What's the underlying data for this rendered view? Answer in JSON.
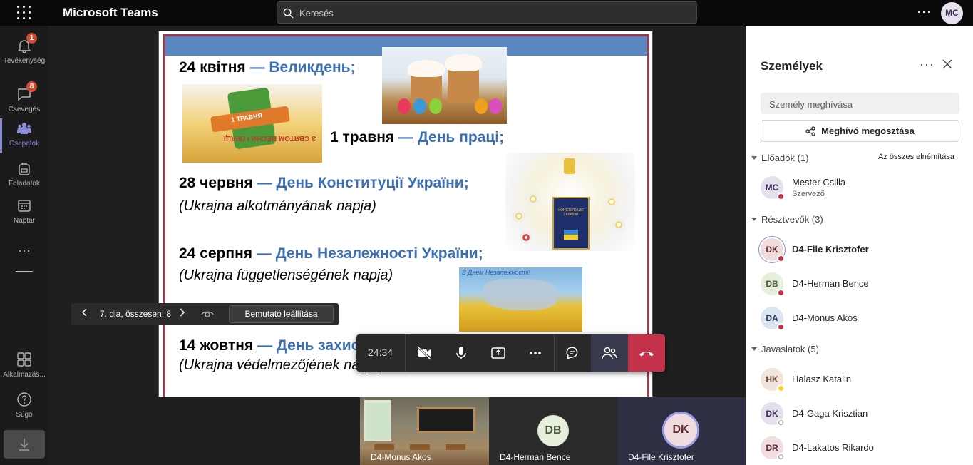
{
  "app": {
    "title": "Microsoft Teams",
    "search_placeholder": "Keresés",
    "avatar_initials": "MC",
    "more": "···"
  },
  "sidebar": {
    "items": [
      {
        "label": "Tevékenység",
        "badge": "1"
      },
      {
        "label": "Csevegés",
        "badge": "8"
      },
      {
        "label": "Csapatok",
        "badge": ""
      },
      {
        "label": "Feladatok",
        "badge": ""
      },
      {
        "label": "Naptár",
        "badge": ""
      }
    ],
    "more": "···",
    "bottom": [
      {
        "label": "Alkalmazás..."
      },
      {
        "label": "Súgó"
      }
    ]
  },
  "slide": {
    "lines": [
      {
        "date": "24 квітня",
        "holiday": "— Великдень;"
      },
      {
        "date": "1 травня",
        "holiday": "— День праці;"
      },
      {
        "date": "28 червня",
        "holiday": "— День Конституції України;"
      },
      {
        "sub": "(Ukrajna alkotmányának napja)"
      },
      {
        "date": "24 серпня",
        "holiday": "— День Незалежності України;"
      },
      {
        "sub": "(Ukrajna függetlenségének napja)"
      },
      {
        "date": "14 жовтня",
        "holiday": "— День захисника України;"
      },
      {
        "sub": "(Ukrajna védelmezőjének napja)"
      }
    ],
    "may_image_text": "З СВЯТОМ ВЕСНИ І ПРАЦІ",
    "may_image_badge": "1 ТРАВНЯ",
    "indep_image_text": "З Днем Незалежності!",
    "const_book_text": "КОНСТИТУЦІЯ УКРАЇНИ"
  },
  "present_bar": {
    "counter": "7. dia, összesen: 8",
    "stop_label": "Bemutató leállítása"
  },
  "call": {
    "timer": "24:34"
  },
  "video_tiles": [
    {
      "name": "D4-Monus Akos",
      "initials": ""
    },
    {
      "name": "D4-Herman Bence",
      "initials": "DB"
    },
    {
      "name": "D4-File Krisztofer",
      "initials": "DK"
    }
  ],
  "panel": {
    "title": "Személyek",
    "more": "···",
    "invite_placeholder": "Személy meghívása",
    "share_label": "Meghívó megosztása",
    "presenters_label": "Előadók (1)",
    "mute_all": "Az összes elnémítása",
    "participants_label": "Résztvevők (3)",
    "suggestions_label": "Javaslatok (5)",
    "presenters": [
      {
        "initials": "MC",
        "name": "Mester Csilla",
        "role": "Szervező"
      }
    ],
    "participants": [
      {
        "initials": "DK",
        "name": "D4-File Krisztofer"
      },
      {
        "initials": "DB",
        "name": "D4-Herman Bence"
      },
      {
        "initials": "DA",
        "name": "D4-Monus Akos"
      }
    ],
    "suggestions": [
      {
        "initials": "HK",
        "name": "Halasz Katalin"
      },
      {
        "initials": "DK",
        "name": "D4-Gaga Krisztian"
      },
      {
        "initials": "DR",
        "name": "D4-Lakatos Rikardo"
      }
    ]
  },
  "colors": {
    "accent": "#8b8cd8",
    "hangup": "#c4314b",
    "slide_blue": "#3b6eb5",
    "slide_band": "#5a86c2",
    "status_busy": "#c4314b",
    "status_away": "#f8d22a"
  }
}
